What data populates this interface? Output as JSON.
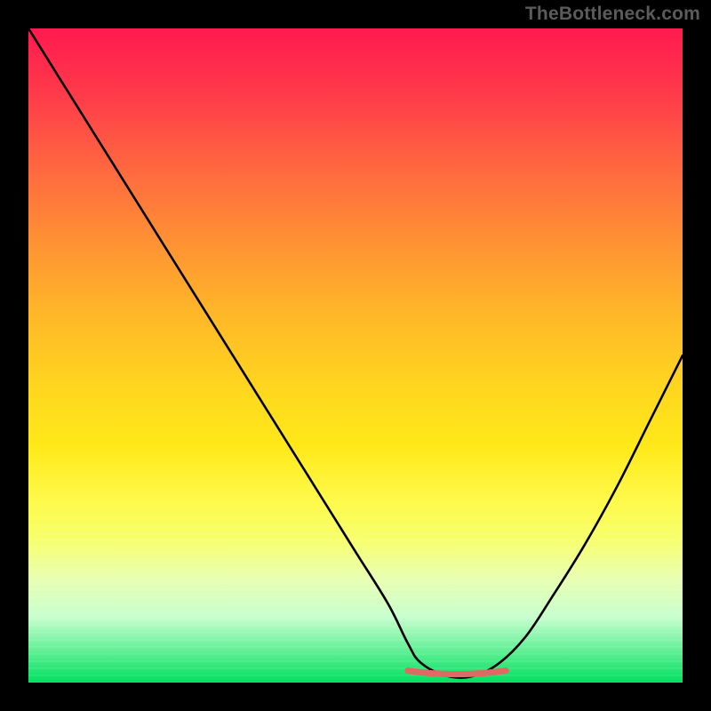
{
  "watermark": "TheBottleneck.com",
  "colors": {
    "background": "#000000",
    "watermark": "#5b5b5b",
    "curve_stroke": "#000000",
    "trough_accent": "#de6a63",
    "gradient_top": "#ff1a4f",
    "gradient_bottom": "#00e060"
  },
  "chart_data": {
    "type": "line",
    "title": "",
    "xlabel": "",
    "ylabel": "",
    "xlim": [
      0,
      100
    ],
    "ylim": [
      0,
      100
    ],
    "note": "Axes are unlabeled in the source image; values are normalized 0–100 by visual estimation. y=100 is top of plot, y=0 is bottom.",
    "series": [
      {
        "name": "curve",
        "x": [
          0,
          5,
          10,
          15,
          20,
          25,
          30,
          35,
          40,
          45,
          50,
          55,
          58,
          60,
          64,
          68,
          72,
          76,
          80,
          85,
          90,
          95,
          100
        ],
        "y": [
          100,
          92,
          84,
          76,
          68,
          60,
          52,
          44,
          36,
          28,
          20,
          12,
          6,
          3,
          1,
          1,
          3,
          7,
          13,
          21,
          30,
          40,
          50
        ]
      }
    ],
    "trough": {
      "x_start": 58,
      "x_end": 73,
      "y": 1
    },
    "legend": [],
    "grid": false
  }
}
